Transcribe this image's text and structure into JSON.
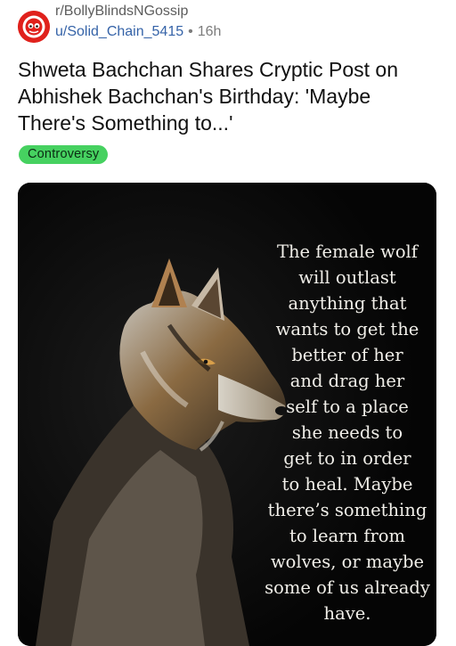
{
  "post": {
    "subreddit": "r/BollyBlindsNGossip",
    "author": "u/Solid_Chain_5415",
    "separator": "•",
    "age": "16h",
    "title": "Shweta Bachchan Shares Cryptic Post on Abhishek Bachchan's Birthday: 'Maybe There's Something to...'",
    "flair": "Controversy",
    "flair_color": "#46d160"
  },
  "image": {
    "subject_icon": "wolf-illustration",
    "quote_lines": [
      "The female wolf",
      "will outlast",
      "anything that",
      "wants to get the",
      "better of her",
      "and drag her",
      "self to a place",
      "she needs to",
      "get to in order",
      "to heal. Maybe",
      "there’s something",
      "to learn from",
      "wolves, or maybe",
      "some of us already",
      "have."
    ]
  }
}
